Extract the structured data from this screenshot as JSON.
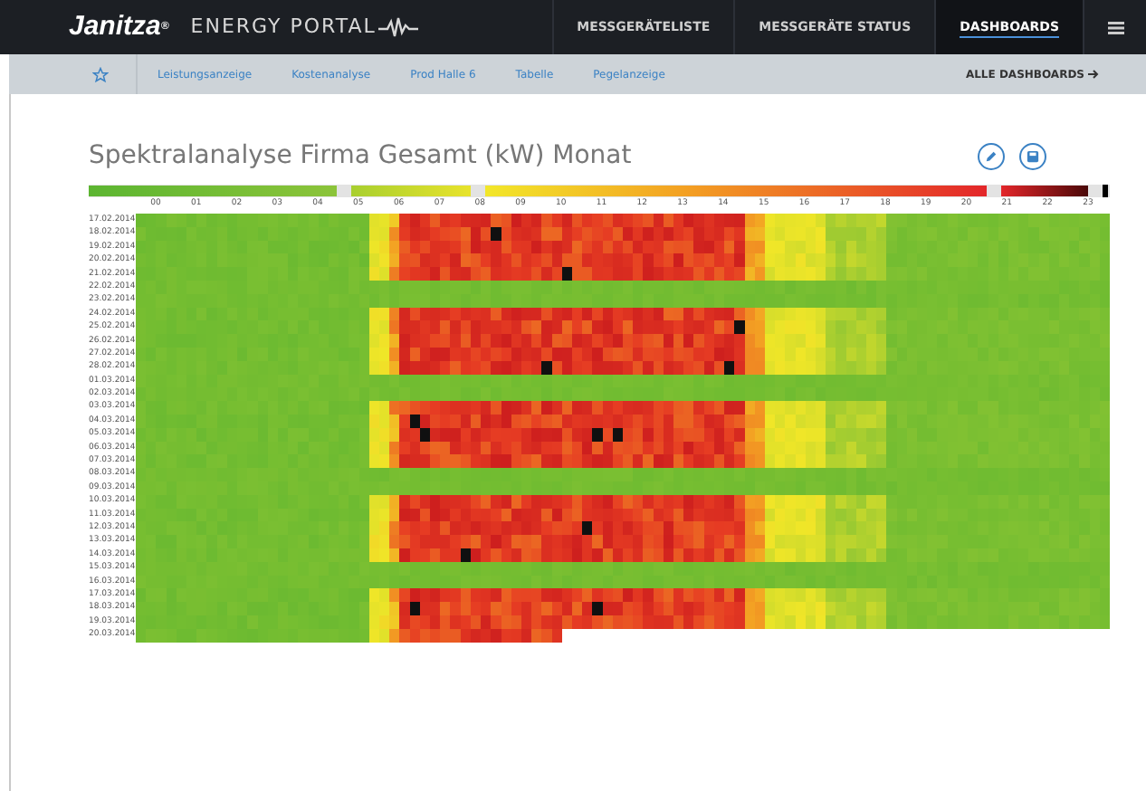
{
  "header": {
    "brand": "Janitza",
    "brand_mark": "®",
    "product": "ENERGY PORTAL",
    "nav": [
      {
        "label": "MESSGERÄTELISTE",
        "selected": false
      },
      {
        "label": "MESSGERÄTE STATUS",
        "selected": false
      },
      {
        "label": "DASHBOARDS",
        "selected": true
      }
    ]
  },
  "subnav": {
    "items": [
      "Leistungsanzeige",
      "Kostenanalyse",
      "Prod Halle 6",
      "Tabelle",
      "Pegelanzeige"
    ],
    "all_link": "ALLE DASHBOARDS"
  },
  "title": "Spektralanalyse Firma Gesamt (kW) Monat",
  "heatmap": {
    "hours": [
      "00",
      "01",
      "02",
      "03",
      "04",
      "05",
      "06",
      "07",
      "08",
      "09",
      "10",
      "11",
      "12",
      "13",
      "14",
      "15",
      "16",
      "17",
      "18",
      "19",
      "20",
      "21",
      "22",
      "23"
    ],
    "rows": [
      {
        "date": "17.02.2014",
        "kind": "workday"
      },
      {
        "date": "18.02.2014",
        "kind": "workday"
      },
      {
        "date": "19.02.2014",
        "kind": "workday"
      },
      {
        "date": "20.02.2014",
        "kind": "workday"
      },
      {
        "date": "21.02.2014",
        "kind": "workday"
      },
      {
        "date": "22.02.2014",
        "kind": "weekend"
      },
      {
        "date": "23.02.2014",
        "kind": "weekend"
      },
      {
        "date": "24.02.2014",
        "kind": "workday"
      },
      {
        "date": "25.02.2014",
        "kind": "workday"
      },
      {
        "date": "26.02.2014",
        "kind": "workday"
      },
      {
        "date": "27.02.2014",
        "kind": "workday"
      },
      {
        "date": "28.02.2014",
        "kind": "workday"
      },
      {
        "date": "01.03.2014",
        "kind": "weekend"
      },
      {
        "date": "02.03.2014",
        "kind": "weekend"
      },
      {
        "date": "03.03.2014",
        "kind": "workday"
      },
      {
        "date": "04.03.2014",
        "kind": "workday"
      },
      {
        "date": "05.03.2014",
        "kind": "workday"
      },
      {
        "date": "06.03.2014",
        "kind": "workday"
      },
      {
        "date": "07.03.2014",
        "kind": "workday"
      },
      {
        "date": "08.03.2014",
        "kind": "weekend"
      },
      {
        "date": "09.03.2014",
        "kind": "weekend"
      },
      {
        "date": "10.03.2014",
        "kind": "workday"
      },
      {
        "date": "11.03.2014",
        "kind": "workday"
      },
      {
        "date": "12.03.2014",
        "kind": "workday"
      },
      {
        "date": "13.03.2014",
        "kind": "workday"
      },
      {
        "date": "14.03.2014",
        "kind": "workday"
      },
      {
        "date": "15.03.2014",
        "kind": "weekend"
      },
      {
        "date": "16.03.2014",
        "kind": "weekend"
      },
      {
        "date": "17.03.2014",
        "kind": "workday"
      },
      {
        "date": "18.03.2014",
        "kind": "workday"
      },
      {
        "date": "19.03.2014",
        "kind": "workday"
      },
      {
        "date": "20.03.2014",
        "kind": "partial"
      }
    ]
  }
}
